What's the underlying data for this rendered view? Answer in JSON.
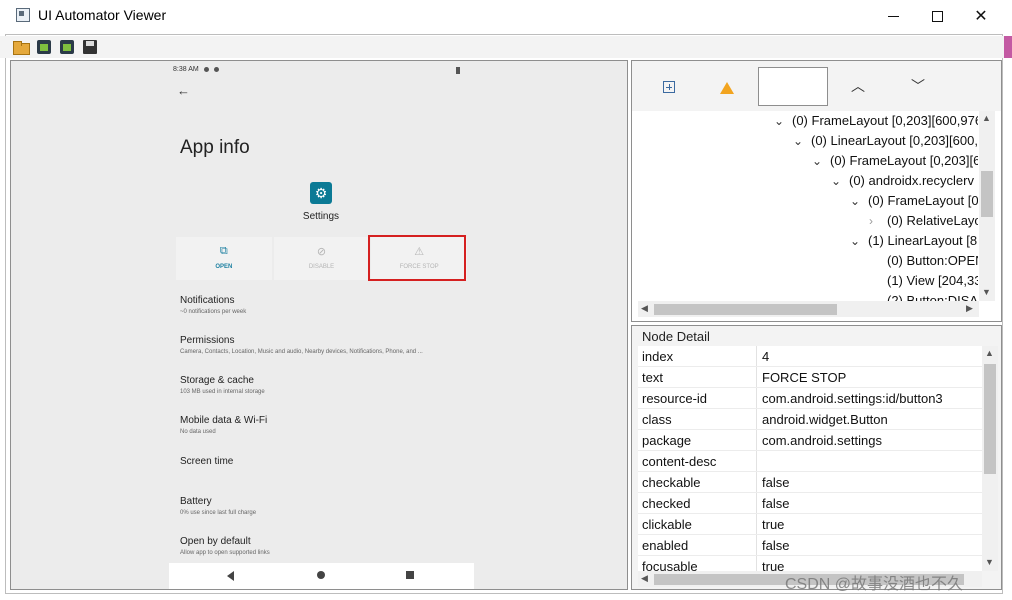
{
  "window": {
    "title": "UI Automator Viewer"
  },
  "toolbar": {
    "icons": [
      "open-folder-icon",
      "device-screenshot-icon",
      "device-screenshot-compressed-icon",
      "save-icon"
    ]
  },
  "device": {
    "status_time": "8:38",
    "status_ampm": "AM",
    "app_info_title": "App info",
    "app_name": "Settings",
    "actions": [
      {
        "label": "OPEN",
        "icon": "open-in-new-icon"
      },
      {
        "label": "DISABLE",
        "icon": "block-icon"
      },
      {
        "label": "FORCE STOP",
        "icon": "warning-icon"
      }
    ],
    "settings": [
      {
        "title": "Notifications",
        "subtitle": "~0 notifications per week"
      },
      {
        "title": "Permissions",
        "subtitle": "Camera, Contacts, Location, Music and audio, Nearby devices, Notifications, Phone, and ..."
      },
      {
        "title": "Storage & cache",
        "subtitle": "103 MB used in internal storage"
      },
      {
        "title": "Mobile data & Wi-Fi",
        "subtitle": "No data used"
      },
      {
        "title": "Screen time",
        "subtitle": ""
      },
      {
        "title": "Battery",
        "subtitle": "0% use since last full charge"
      },
      {
        "title": "Open by default",
        "subtitle": "Allow app to open supported links"
      }
    ]
  },
  "hierarchy": {
    "rows": [
      {
        "text": "(0) FrameLayout [0,203][600,976",
        "indent": 0,
        "toggle": "expanded"
      },
      {
        "text": "(0) LinearLayout [0,203][600,",
        "indent": 1,
        "toggle": "expanded"
      },
      {
        "text": "(0) FrameLayout [0,203][6",
        "indent": 2,
        "toggle": "expanded"
      },
      {
        "text": "(0) androidx.recyclerv",
        "indent": 3,
        "toggle": "expanded"
      },
      {
        "text": "(0) FrameLayout [0",
        "indent": 4,
        "toggle": "expanded"
      },
      {
        "text": "(0) RelativeLayo",
        "indent": 5,
        "toggle": "collapsed"
      },
      {
        "text": "(1) LinearLayout [8",
        "indent": 4,
        "toggle": "expanded"
      },
      {
        "text": "(0) Button:OPEN",
        "indent": 5,
        "toggle": "none"
      },
      {
        "text": "(1) View [204,33",
        "indent": 5,
        "toggle": "none"
      },
      {
        "text": "(2) Button:DISA",
        "indent": 5,
        "toggle": "none"
      }
    ]
  },
  "node_detail": {
    "title": "Node Detail",
    "rows": [
      {
        "key": "index",
        "value": "4"
      },
      {
        "key": "text",
        "value": "FORCE STOP"
      },
      {
        "key": "resource-id",
        "value": "com.android.settings:id/button3"
      },
      {
        "key": "class",
        "value": "android.widget.Button"
      },
      {
        "key": "package",
        "value": "com.android.settings"
      },
      {
        "key": "content-desc",
        "value": ""
      },
      {
        "key": "checkable",
        "value": "false"
      },
      {
        "key": "checked",
        "value": "false"
      },
      {
        "key": "clickable",
        "value": "true"
      },
      {
        "key": "enabled",
        "value": "false"
      },
      {
        "key": "focusable",
        "value": "true"
      }
    ]
  },
  "watermark": "CSDN @故事没酒也不久"
}
